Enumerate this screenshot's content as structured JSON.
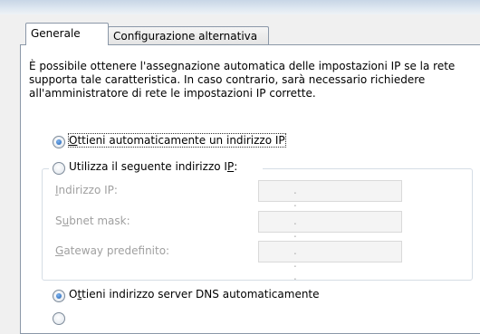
{
  "tabs": [
    {
      "label": "Generale",
      "active": true
    },
    {
      "label": "Configurazione alternativa",
      "active": false
    }
  ],
  "intro_text": "È possibile ottenere l'assegnazione automatica delle impostazioni IP se la rete supporta tale caratteristica. In caso contrario, sarà necessario richiedere all'amministratore di rete le impostazioni IP corrette.",
  "ip_options": {
    "auto": {
      "pre": "",
      "key": "O",
      "post": "ttieni automaticamente un indirizzo IP",
      "selected": true
    },
    "manual": {
      "pre": "Utilizza il seguente indirizzo I",
      "key": "P",
      "post": ":",
      "selected": false
    }
  },
  "fields": [
    {
      "pre": "",
      "key": "I",
      "post": "ndirizzo IP:",
      "value": ". . ."
    },
    {
      "pre": "S",
      "key": "u",
      "post": "bnet mask:",
      "value": ". . ."
    },
    {
      "pre": "",
      "key": "G",
      "post": "ateway predefinito:",
      "value": ". . ."
    }
  ],
  "dns_options": {
    "auto": {
      "pre": "O",
      "key": "t",
      "post": "tieni indirizzo server DNS automaticamente",
      "selected": true
    }
  },
  "colors": {
    "accent": "#1c5fb3",
    "border": "#8b98a8",
    "disabled_text": "#a0a0a0"
  }
}
